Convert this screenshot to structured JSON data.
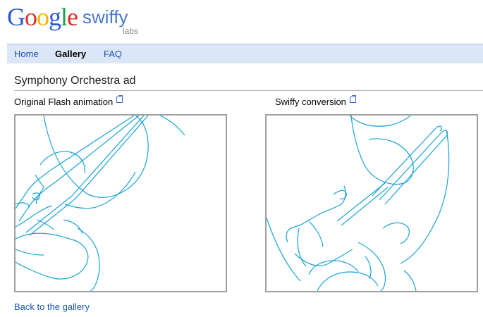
{
  "logo": {
    "google_letters": [
      {
        "ch": "G",
        "color": "#2a5bd7"
      },
      {
        "ch": "o",
        "color": "#d93025"
      },
      {
        "ch": "o",
        "color": "#f1b600"
      },
      {
        "ch": "g",
        "color": "#2a5bd7"
      },
      {
        "ch": "l",
        "color": "#18a04a"
      },
      {
        "ch": "e",
        "color": "#d93025"
      }
    ],
    "product": "swiffy",
    "sub": "labs"
  },
  "nav": {
    "home": "Home",
    "gallery": "Gallery",
    "faq": "FAQ"
  },
  "page": {
    "title": "Symphony Orchestra ad"
  },
  "panels": {
    "left_label": "Original Flash animation",
    "right_label": "Swiffy conversion"
  },
  "colors": {
    "line": "#1aa3d6",
    "nav_bg": "#dbe6f6",
    "link": "#1a55b5"
  },
  "icons": {
    "external": "external-link-icon"
  },
  "footer": {
    "back_link": "Back to the gallery"
  }
}
